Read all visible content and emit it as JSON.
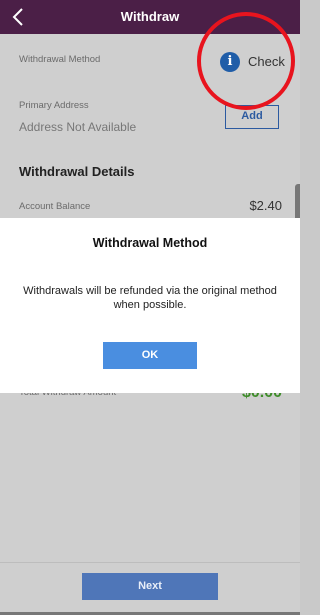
{
  "header": {
    "title": "Withdraw",
    "back_icon": "chevron-left-icon"
  },
  "withdrawal_method": {
    "label": "Withdrawal Method",
    "value": "Check",
    "icon": "info-icon",
    "icon_glyph": "i"
  },
  "primary_address": {
    "label": "Primary Address",
    "value": "Address Not Available",
    "add_label": "Add"
  },
  "withdrawal_details": {
    "heading": "Withdrawal Details",
    "account_balance_label": "Account Balance",
    "account_balance_value": "$2.40",
    "total_label": "Total Withdraw Amount",
    "total_value": "$0.00"
  },
  "footer": {
    "next_label": "Next"
  },
  "modal": {
    "title": "Withdrawal Method",
    "body": "Withdrawals will be refunded via the original method when possible.",
    "ok_label": "OK"
  },
  "colors": {
    "header_bg": "#4b1f47",
    "accent_blue": "#4a8ee0",
    "total_green": "#3f8c2a",
    "annotation_red": "#e8141e"
  }
}
